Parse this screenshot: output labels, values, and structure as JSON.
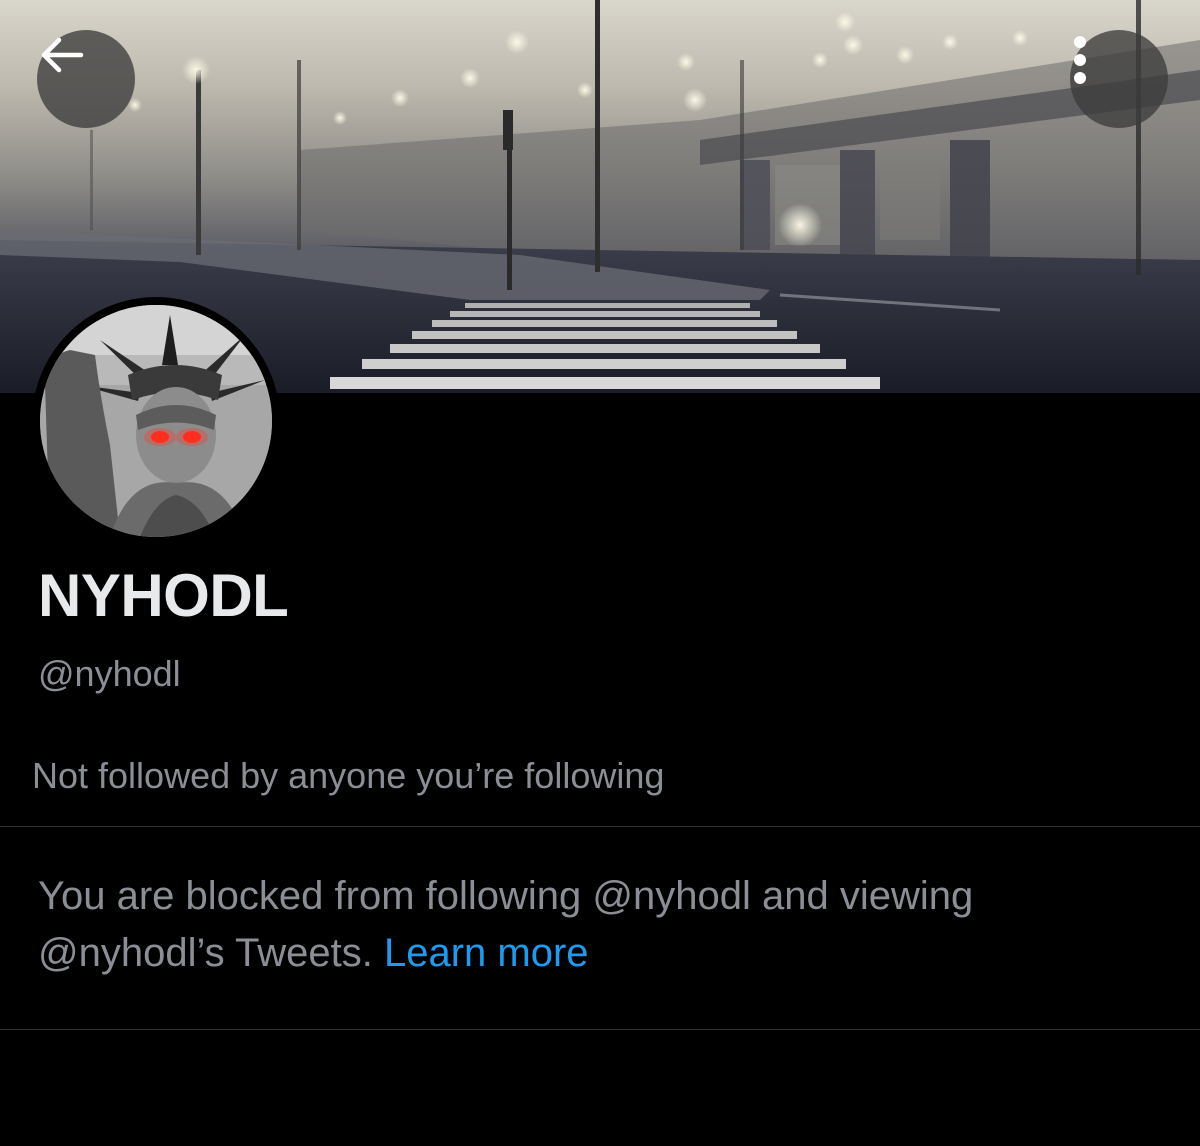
{
  "header": {
    "back_icon": "arrow-left-icon",
    "more_icon": "vertical-ellipsis-icon"
  },
  "profile": {
    "display_name": "NYHODL",
    "handle": "@nyhodl",
    "social_context": "Not followed by anyone you’re following"
  },
  "blocked": {
    "message": "You are blocked from following @nyhodl and viewing @nyhodl’s Tweets. ",
    "link_label": "Learn more"
  },
  "colors": {
    "background": "#000000",
    "primary_text": "#e7e9ea",
    "secondary_text": "#8b8f95",
    "link": "#1d9bf0",
    "divider": "#2a2d31"
  }
}
